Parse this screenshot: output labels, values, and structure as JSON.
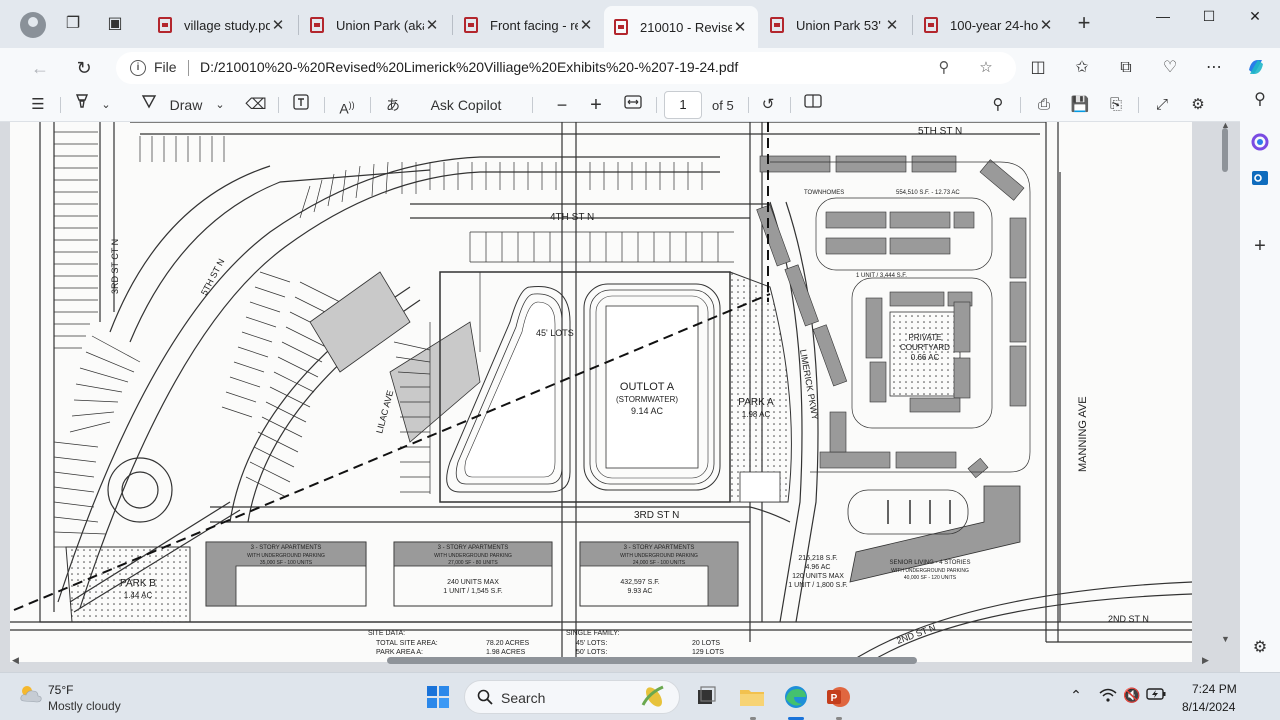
{
  "browser": {
    "tabs": [
      {
        "title": "village study.pdf",
        "active": false
      },
      {
        "title": "Union Park (aka",
        "active": false
      },
      {
        "title": "Front facing - re",
        "active": false
      },
      {
        "title": "210010 - Revised",
        "active": true
      },
      {
        "title": "Union Park 53' R",
        "active": false
      },
      {
        "title": "100-year 24-hou",
        "active": false
      }
    ],
    "close_glyph": "✕",
    "new_tab_glyph": "+",
    "window": {
      "minimize": "—",
      "maximize": "☐",
      "close": "✕"
    },
    "address": {
      "scheme_label": "File",
      "url": "D:/210010%20-%20Revised%20Limerick%20Villiage%20Exhibits%20-%207-19-24.pdf"
    }
  },
  "pdf_toolbar": {
    "draw_label": "Draw",
    "copilot_label": "Ask Copilot",
    "page_current": "1",
    "page_total_label": "of 5",
    "zoom_out": "−",
    "zoom_in": "+"
  },
  "site_plan": {
    "streets": {
      "fifth_st": "5TH ST N",
      "fourth_st": "4TH ST N",
      "third_st": "3RD ST N",
      "second_st_a": "2ND ST N",
      "second_st_b": "2ND ST N",
      "third_st_ct": "3RD ST CT N",
      "fifth_st_curve": "5TH ST N",
      "lilac": "LILAC AVE",
      "limerick": "LIMERICK PKWY",
      "manning": "MANNING AVE"
    },
    "outlot": {
      "name": "OUTLOT A",
      "use": "(STORMWATER)",
      "area": "9.14 AC"
    },
    "park_a": {
      "name": "PARK A",
      "area": "1.98 AC"
    },
    "park_b": {
      "name": "PARK B",
      "area": "1.44 AC"
    },
    "lots_45": "45' LOTS",
    "townhomes": {
      "label": "TOWNHOMES",
      "area": "554,510 S.F. - 12.73 AC",
      "unit": "1 UNIT / 3,444 S.F."
    },
    "courtyard": {
      "line1": "PRIVATE",
      "line2": "COURTYARD",
      "area": "0.66 AC"
    },
    "apartments": [
      {
        "line1": "3 - STORY APARTMENTS",
        "line2": "WITH UNDERGROUND PARKING",
        "line3": "35,000 SF - 100 UNITS"
      },
      {
        "line1": "3 - STORY APARTMENTS",
        "line2": "WITH UNDERGROUND PARKING",
        "line3": "27,000 SF - 80 UNITS"
      },
      {
        "line1": "3 - STORY APARTMENTS",
        "line2": "WITH UNDERGROUND PARKING",
        "line3": "24,000 SF - 100 UNITS"
      }
    ],
    "apt_summary": {
      "units": "240 UNITS MAX",
      "unit": "1 UNIT / 1,545 S.F.",
      "sf": "432,597 S.F.",
      "ac": "9.93 AC"
    },
    "senior": {
      "line1": "SENIOR LIVING - 4 STORIES",
      "line2": "WITH UNDERGROUND PARKING",
      "line3": "40,000 SF - 120 UNITS"
    },
    "senior_summary": {
      "sf": "216,218 S.F.",
      "ac": "4.96 AC",
      "units": "120 UNITS MAX",
      "unit": "1 UNIT / 1,800 S.F."
    },
    "site_data": {
      "title": "SITE DATA:",
      "row1_label": "TOTAL SITE AREA:",
      "row1_value": "78.20 ACRES",
      "row2_label": "PARK AREA A:",
      "row2_value": "1.98 ACRES"
    },
    "single_family": {
      "title": "SINGLE FAMILY:",
      "row1_label": "45' LOTS:",
      "row1_value": "20 LOTS",
      "row2_label": "50' LOTS:",
      "row2_value": "129 LOTS"
    }
  },
  "taskbar": {
    "weather_temp": "75°F",
    "weather_desc": "Mostly cloudy",
    "search_label": "Search",
    "time": "7:24 PM",
    "date": "8/14/2024"
  }
}
